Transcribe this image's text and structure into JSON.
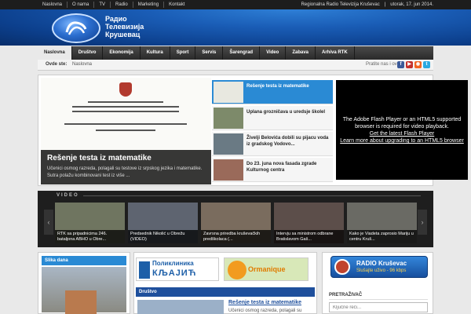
{
  "topbar": {
    "links": [
      "Naslovna",
      "O nama",
      "TV",
      "Radio",
      "Marketing",
      "Kontakt"
    ],
    "station": "Regionalna Radio Televizija Kruševac",
    "date": "utorak, 17. jun 2014."
  },
  "header": {
    "logo_lines": [
      "Радио",
      "Телевизија",
      "Крушевац"
    ]
  },
  "nav": {
    "items": [
      "Naslovna",
      "Društvo",
      "Ekonomija",
      "Kultura",
      "Sport",
      "Servis",
      "Šarengrad",
      "Video",
      "Zabava",
      "Arhiva RTK"
    ],
    "active": "Naslovna"
  },
  "breadcrumb": {
    "label": "Ovde ste:",
    "current": "Naslovna",
    "follow": "Pratite nas i ovde:",
    "social_icons": [
      "facebook-icon",
      "youtube-icon",
      "rss-icon",
      "twitter-icon"
    ]
  },
  "featured": {
    "title": "Rešenje testa iz matematike",
    "summary": "Učenici osmog razreda, polagali su testove iz srpskog jezika i matematike. Sutra polažu kombinovani test iz više ...",
    "items": [
      "Rešenje testa iz matematike",
      "Uplana grozničava u uredsje školel",
      "Živelji Belovića dobili su pijacu voda iz gradskog Vodovo...",
      "Do 23. juna nova fasada zgrade Kulturnog centra",
      ""
    ],
    "flash": {
      "line1": "The Adobe Flash Player or an HTML5 supported browser is required for video playback.",
      "link1": "Get the latest Flash Player",
      "link2": "Learn more about upgrading to an HTML5 browser"
    }
  },
  "video": {
    "label": "VIDEO",
    "items": [
      "RTK sa pripadnicima 246. bataljona ABHO u Obre...",
      "Predsednik Nikolić u Obrežu (VIDEO)",
      "Zavrsna priredba kruševačkih predškolaca (...",
      "Intervju sa ministrom odbrane Bratislavom Gaš...",
      "Kako je Viadeta zaprosio Mariju u centru Kruš..."
    ]
  },
  "bottom": {
    "photo_header": "Slika dana",
    "ad1_line1": "Поликлиника",
    "ad1_line2": "КЉАЈИЋ",
    "ad2_text": "Ormanique",
    "section_header": "Društvo",
    "news_title": "Rešenje testa iz matematike",
    "news_desc": "Učenici osmog razreda, polagali su",
    "radio_line1": "RADIO Kruševac",
    "radio_line2": "Slušajte uživo - 96 kbps",
    "search_header": "PRETRAŽIVAČ",
    "search_placeholder": "Ključne reči..."
  }
}
